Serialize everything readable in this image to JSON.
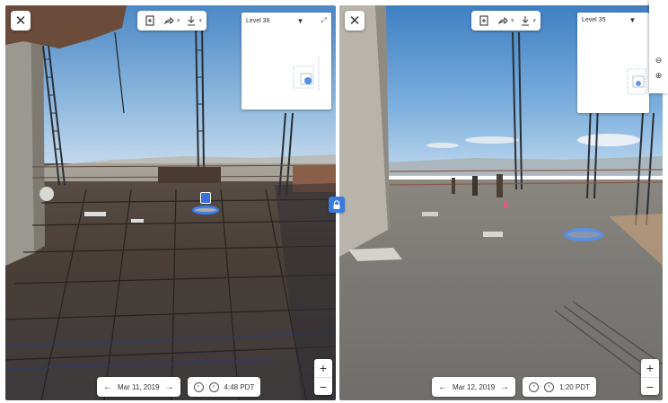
{
  "left_view": {
    "close_label": "✕",
    "toolbar": {
      "icons": [
        "new-note-icon",
        "share-icon",
        "download-icon"
      ]
    },
    "minimap": {
      "level": "Level 36"
    },
    "date_bar": {
      "date": "Mar 11, 2019",
      "time": "4:48 PDT"
    },
    "zoom": {
      "in": "+",
      "out": "−"
    }
  },
  "right_view": {
    "close_label": "✕",
    "toolbar": {
      "icons": [
        "new-note-icon",
        "share-icon",
        "download-icon"
      ]
    },
    "minimap": {
      "level": "Level 35"
    },
    "date_bar": {
      "date": "Mar 12, 2019",
      "time": "1:20 PDT"
    },
    "zoom": {
      "in": "+",
      "out": "−"
    }
  },
  "colors": {
    "accent": "#3a7be0",
    "ui_bg": "#ffffff"
  }
}
